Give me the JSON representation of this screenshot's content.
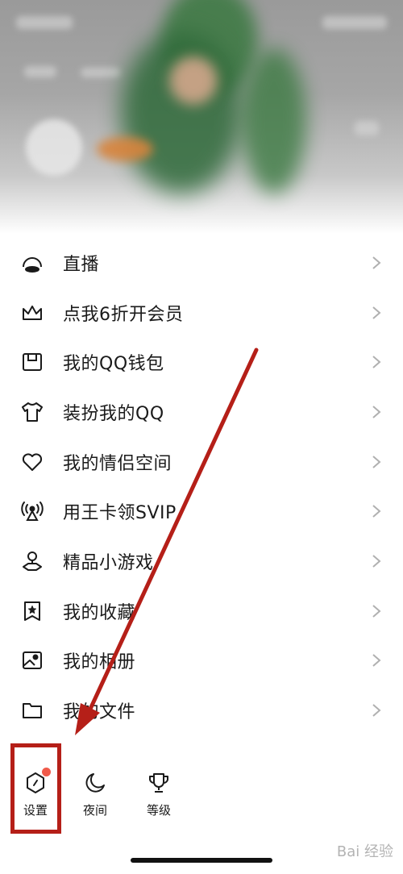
{
  "menu": {
    "items": [
      {
        "label": "直播",
        "icon": "live-icon"
      },
      {
        "label": "点我6折开会员",
        "icon": "crown-icon"
      },
      {
        "label": "我的QQ钱包",
        "icon": "wallet-icon"
      },
      {
        "label": "装扮我的QQ",
        "icon": "tshirt-icon"
      },
      {
        "label": "我的情侣空间",
        "icon": "heart-icon"
      },
      {
        "label": "用王卡领SVIP",
        "icon": "signal-tower-icon"
      },
      {
        "label": "精品小游戏",
        "icon": "game-icon"
      },
      {
        "label": "我的收藏",
        "icon": "bookmark-star-icon"
      },
      {
        "label": "我的相册",
        "icon": "photo-icon"
      },
      {
        "label": "我的文件",
        "icon": "folder-icon"
      }
    ]
  },
  "bottom_bar": {
    "settings": {
      "label": "设置",
      "icon": "settings-icon",
      "has_notification_dot": true
    },
    "night": {
      "label": "夜间",
      "icon": "moon-icon"
    },
    "level": {
      "label": "等级",
      "icon": "trophy-icon"
    }
  },
  "colors": {
    "annotation": "#b51f18",
    "notification_dot": "#f05a4a"
  },
  "watermark": {
    "text": "Bai 经验"
  }
}
